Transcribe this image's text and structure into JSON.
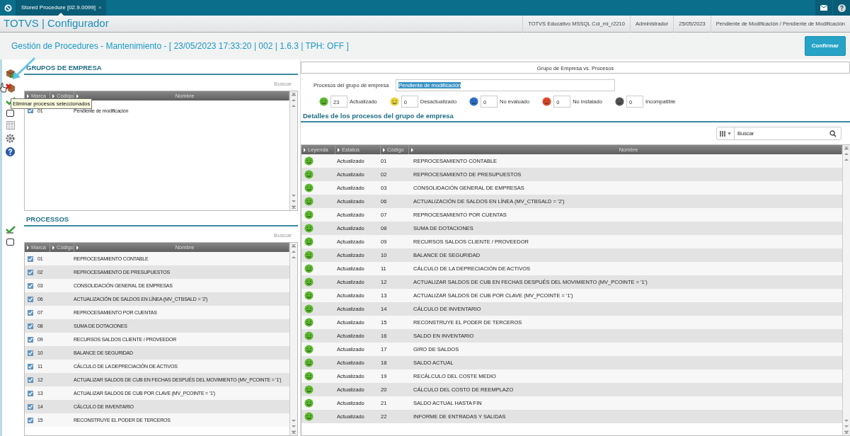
{
  "topbar": {
    "tab_title": "Stored Procedure [02.9.0099]",
    "tab_close": "×"
  },
  "header": {
    "app_title": "TOTVS | Configurador",
    "info": [
      "TOTVS Educativo MSSQL Col_mi_r2210",
      "Administrador",
      "25/05/2023",
      "Pendiente de Modificación / Pendiente de Modificación"
    ]
  },
  "page": {
    "title": "Gestión de Procedures - Mantenimiento - [ 23/05/2023 17:33:20 | 002 | 1.6.3 | TPH: OFF ]",
    "confirm_button": "Confirmar"
  },
  "toolbar": {
    "tooltip": "Eliminar procesos seleccionados"
  },
  "groups": {
    "title": "GRUPOS DE EMPRESA",
    "search_label": "Buscar",
    "columns": [
      "Marca",
      "Código",
      "Nombre"
    ],
    "rows": [
      {
        "checked": true,
        "code": "01",
        "name": "Pendiente de modificación"
      }
    ]
  },
  "processes": {
    "title": "PROCESSOS",
    "search_label": "Buscar",
    "columns": [
      "Marca",
      "Código",
      "Nombre"
    ],
    "rows": [
      {
        "checked": true,
        "code": "01",
        "name": "REPROCESAMIENTO CONTABLE"
      },
      {
        "checked": true,
        "code": "02",
        "name": "REPROCESAMIENTO DE PRESUPUESTOS"
      },
      {
        "checked": true,
        "code": "03",
        "name": "CONSOLIDACIÓN GENERAL DE EMPRESAS"
      },
      {
        "checked": true,
        "code": "06",
        "name": "ACTUALIZACIÓN DE SALDOS EN LÍNEA (MV_CTBSALD = '2')"
      },
      {
        "checked": true,
        "code": "07",
        "name": "REPROCESAMIENTO POR CUENTAS"
      },
      {
        "checked": true,
        "code": "08",
        "name": "SUMA DE DOTACIONES"
      },
      {
        "checked": true,
        "code": "09",
        "name": "RECURSOS SALDOS CLIENTE / PROVEEDOR"
      },
      {
        "checked": true,
        "code": "10",
        "name": "BALANCE DE SEGURIDAD"
      },
      {
        "checked": true,
        "code": "11",
        "name": "CÁLCULO DE LA DEPRECIACIÓN DE ACTIVOS"
      },
      {
        "checked": true,
        "code": "12",
        "name": "ACTUALIZAR SALDOS DE CUB EN FECHAS DESPUÉS DEL MOVIMIENTO (MV_PCOINTE = '1')"
      },
      {
        "checked": true,
        "code": "13",
        "name": "ACTUALIZAR SALDOS DE CUB POR CLAVE (MV_PCOINTE = '1')"
      },
      {
        "checked": true,
        "code": "14",
        "name": "CÁLCULO DE INVENTARIO"
      },
      {
        "checked": true,
        "code": "15",
        "name": "RECONSTRUYE EL PODER DE TERCEROS"
      }
    ]
  },
  "comparison": {
    "title": "Grupo de Empresa vs. Procesos",
    "field_label": "Procesos del grupo de empresa",
    "field_value": "Pendiente de modificación",
    "counters": [
      {
        "color": "#5cb82e",
        "value": "23",
        "label": "Actualizado"
      },
      {
        "color": "#e8d23a",
        "value": "0",
        "label": "Desactualizado"
      },
      {
        "color": "#2a6fc9",
        "value": "0",
        "label": "No evaluado"
      },
      {
        "color": "#e0492a",
        "value": "0",
        "label": "No instalado"
      },
      {
        "color": "#555555",
        "value": "0",
        "label": "Incompatible"
      }
    ]
  },
  "details": {
    "title": "Detalles de los procesos del grupo de empresa",
    "search_placeholder": "Buscar",
    "columns": [
      "Leyenda",
      "Estatus",
      "Código",
      "Nombre"
    ],
    "rows": [
      {
        "color": "#5cb82e",
        "status": "Actualizado",
        "code": "01",
        "name": "REPROCESAMIENTO CONTABLE"
      },
      {
        "color": "#5cb82e",
        "status": "Actualizado",
        "code": "02",
        "name": "REPROCESAMIENTO DE PRESUPUESTOS"
      },
      {
        "color": "#5cb82e",
        "status": "Actualizado",
        "code": "03",
        "name": "CONSOLIDACIÓN GENERAL DE EMPRESAS"
      },
      {
        "color": "#5cb82e",
        "status": "Actualizado",
        "code": "06",
        "name": "ACTUALIZACIÓN DE SALDOS EN LÍNEA (MV_CTBSALD = '2')"
      },
      {
        "color": "#5cb82e",
        "status": "Actualizado",
        "code": "07",
        "name": "REPROCESAMIENTO POR CUENTAS"
      },
      {
        "color": "#5cb82e",
        "status": "Actualizado",
        "code": "08",
        "name": "SUMA DE DOTACIONES"
      },
      {
        "color": "#5cb82e",
        "status": "Actualizado",
        "code": "09",
        "name": "RECURSOS SALDOS CLIENTE / PROVEEDOR"
      },
      {
        "color": "#5cb82e",
        "status": "Actualizado",
        "code": "10",
        "name": "BALANCE DE SEGURIDAD"
      },
      {
        "color": "#5cb82e",
        "status": "Actualizado",
        "code": "11",
        "name": "CÁLCULO DE LA DEPRECIACIÓN DE ACTIVOS"
      },
      {
        "color": "#5cb82e",
        "status": "Actualizado",
        "code": "12",
        "name": "ACTUALIZAR SALDOS DE CUB EN FECHAS DESPUÉS DEL MOVIMIENTO (MV_PCOINTE = '1')"
      },
      {
        "color": "#5cb82e",
        "status": "Actualizado",
        "code": "13",
        "name": "ACTUALIZAR SALDOS DE CUB POR CLAVE (MV_PCOINTE = '1')"
      },
      {
        "color": "#5cb82e",
        "status": "Actualizado",
        "code": "14",
        "name": "CÁLCULO DE INVENTARIO"
      },
      {
        "color": "#5cb82e",
        "status": "Actualizado",
        "code": "15",
        "name": "RECONSTRUYE EL PODER DE TERCEROS"
      },
      {
        "color": "#5cb82e",
        "status": "Actualizado",
        "code": "16",
        "name": "SALDO EN INVENTARIO"
      },
      {
        "color": "#5cb82e",
        "status": "Actualizado",
        "code": "17",
        "name": "GIRO DE SALDOS"
      },
      {
        "color": "#5cb82e",
        "status": "Actualizado",
        "code": "18",
        "name": "SALDO ACTUAL"
      },
      {
        "color": "#5cb82e",
        "status": "Actualizado",
        "code": "19",
        "name": "RECÁLCULO DEL COSTE MEDIO"
      },
      {
        "color": "#5cb82e",
        "status": "Actualizado",
        "code": "20",
        "name": "CÁLCULO DEL COSTO DE REEMPLAZO"
      },
      {
        "color": "#5cb82e",
        "status": "Actualizado",
        "code": "21",
        "name": "SALDO ACTUAL HASTA FIN"
      },
      {
        "color": "#5cb82e",
        "status": "Actualizado",
        "code": "22",
        "name": "INFORME DE ENTRADAS Y SALIDAS"
      }
    ]
  }
}
